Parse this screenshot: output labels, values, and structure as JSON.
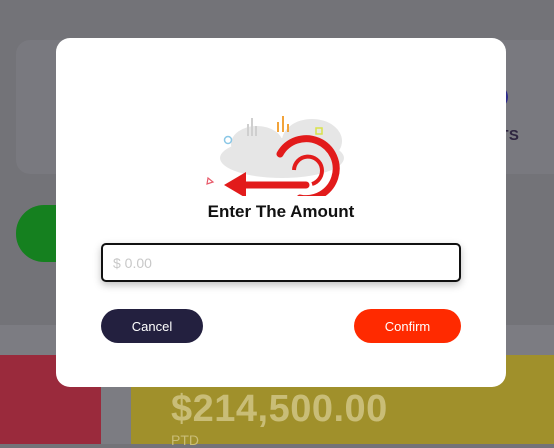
{
  "background": {
    "card_label": "ENTS",
    "amount": "$214,500.00",
    "amount_sub": "PTD"
  },
  "modal": {
    "icon": "logout-arrow-icon",
    "title": "Enter The Amount",
    "input_placeholder": "$ 0.00",
    "cancel_label": "Cancel",
    "confirm_label": "Confirm"
  },
  "colors": {
    "accent_red": "#ff2a00",
    "dark_button": "#23203f"
  }
}
